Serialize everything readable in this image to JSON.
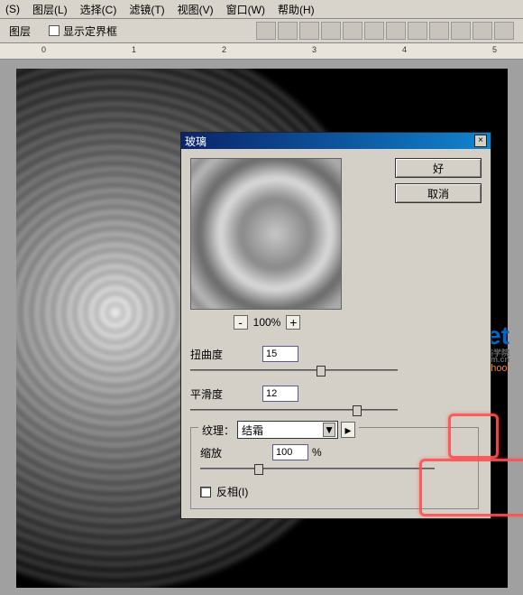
{
  "menubar": [
    "(S)",
    "图层(L)",
    "选择(C)",
    "滤镜(T)",
    "视图(V)",
    "窗口(W)",
    "帮助(H)"
  ],
  "optionbar": {
    "layer_label": "图层",
    "show_bbox": "显示定界框"
  },
  "ruler_marks": [
    "0",
    "1",
    "2",
    "3",
    "4",
    "5"
  ],
  "dialog": {
    "title": "玻璃",
    "ok": "好",
    "cancel": "取消",
    "zoom_pct": "100%",
    "distortion_label": "扭曲度",
    "distortion_value": "15",
    "smoothness_label": "平滑度",
    "smoothness_value": "12",
    "texture_label": "纹理：",
    "texture_value": "结霜",
    "scale_label": "缩放",
    "scale_value": "100",
    "scale_unit": "%",
    "invert": "反相(I)",
    "minus": "-",
    "plus": "+",
    "close_x": "×",
    "arrow_down": "▼",
    "tex_arrow": "▸"
  },
  "watermark": {
    "e": "e",
    "net": "Net",
    "sup1": "网络学院",
    "sup2": ".com.cn",
    "url": "www.eNet.com.cn/eschool"
  }
}
